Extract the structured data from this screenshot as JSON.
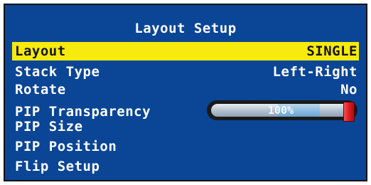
{
  "menu": {
    "title": "Layout Setup",
    "items": [
      {
        "label": "Layout",
        "value": "SINGLE",
        "selected": true
      },
      {
        "label": "Stack Type",
        "value": "Left-Right"
      },
      {
        "label": "Rotate",
        "value": "No"
      },
      {
        "label": "PIP Transparency",
        "value": "100%",
        "level_percent": 100
      },
      {
        "label": "PIP Size"
      },
      {
        "label": "PIP Position"
      },
      {
        "label": "Flip Setup"
      }
    ]
  },
  "colors": {
    "background": "#0a4596",
    "highlight": "#f7ea0d",
    "text": "#ffffff",
    "slider_thumb": "#e21f26"
  }
}
